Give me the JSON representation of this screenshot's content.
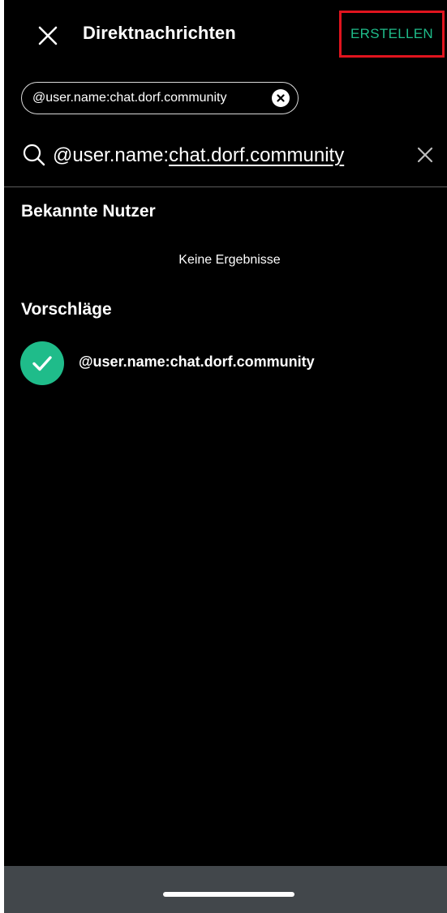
{
  "header": {
    "title": "Direktnachrichten",
    "close_icon": "close-icon",
    "create_label": "ERSTELLEN"
  },
  "selected_chip": {
    "label": "@user.name:chat.dorf.community",
    "remove_icon": "remove-circle-icon"
  },
  "search": {
    "value_prefix": "@user.name:",
    "value_suffix": "chat.dorf.community",
    "search_icon": "search-icon",
    "clear_icon": "close-icon"
  },
  "known_users": {
    "header": "Bekannte Nutzer",
    "empty_text": "Keine Ergebnisse"
  },
  "suggestions": {
    "header": "Vorschläge",
    "items": [
      {
        "label": "@user.name:chat.dorf.community",
        "icon": "check-icon",
        "selected": true
      }
    ]
  },
  "colors": {
    "background": "#000000",
    "accent": "#1fbc8a",
    "highlight_border": "#e0141e",
    "navbar": "#42474b"
  }
}
